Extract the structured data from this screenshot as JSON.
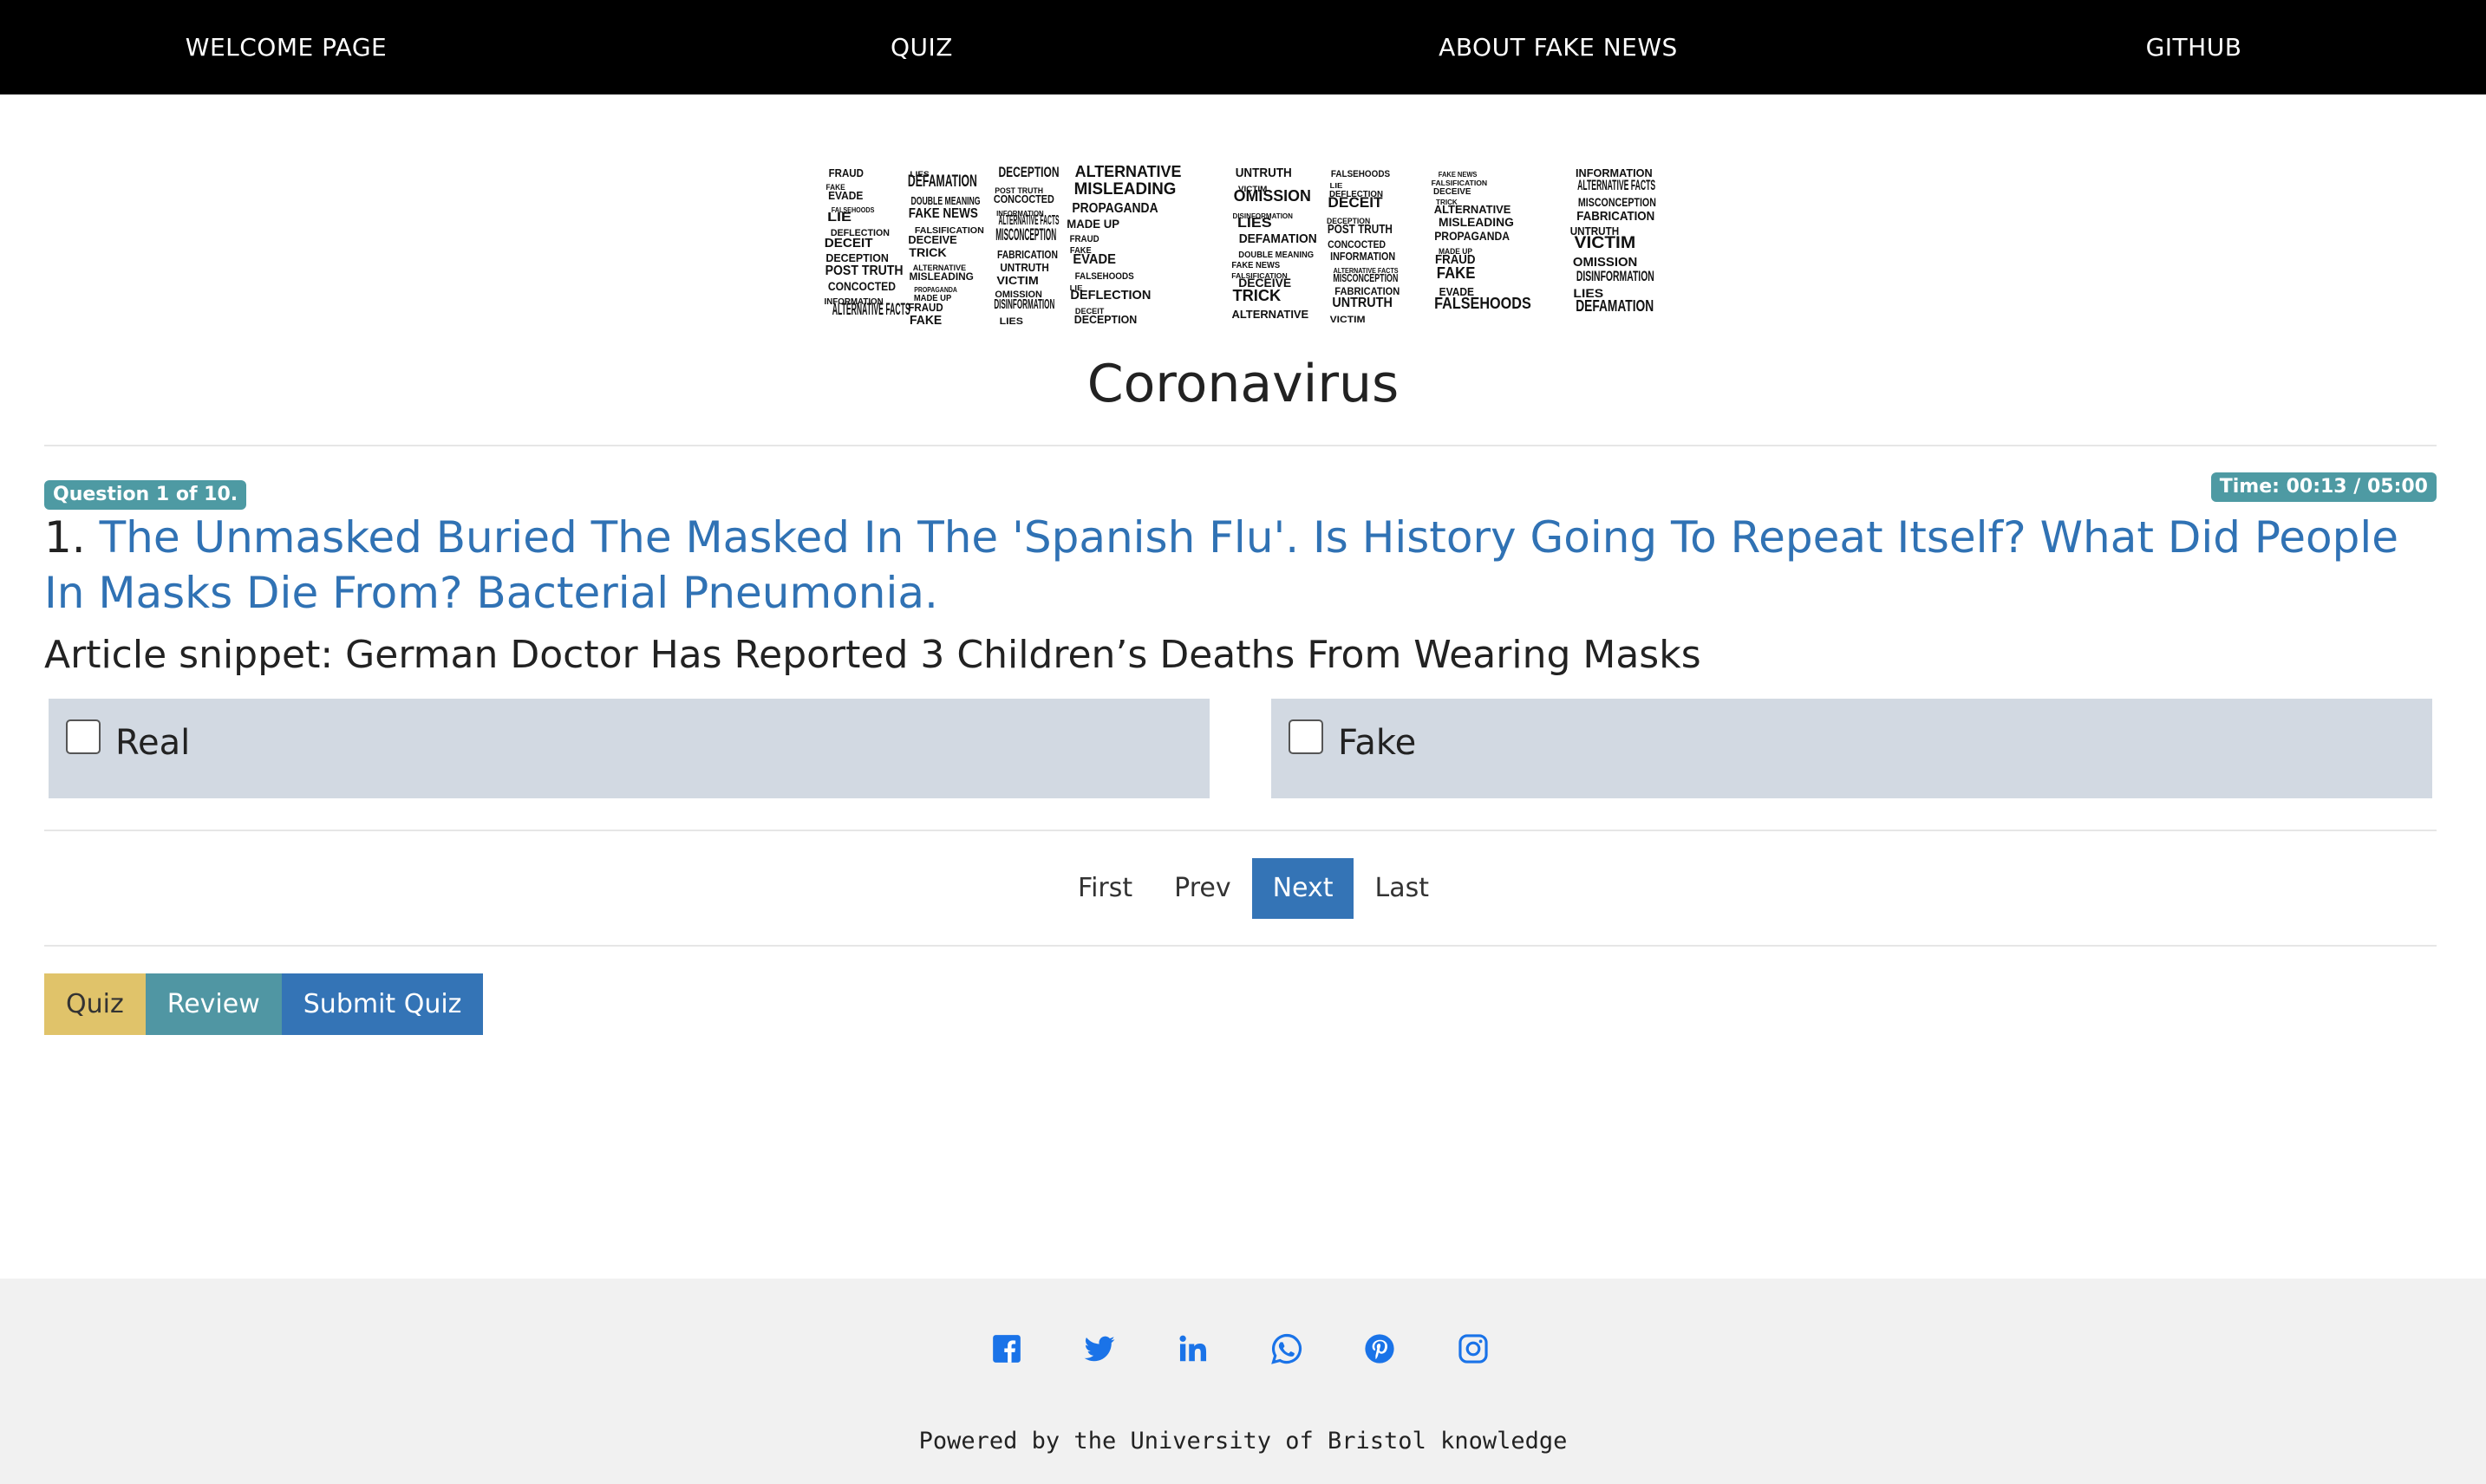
{
  "nav": {
    "items": [
      {
        "label": "WELCOME PAGE"
      },
      {
        "label": "QUIZ"
      },
      {
        "label": "ABOUT FAKE NEWS"
      },
      {
        "label": "GITHUB"
      }
    ]
  },
  "header": {
    "title": "Coronavirus",
    "logo_words": [
      "FRAUD",
      "DECEIT",
      "MISCONCEPTION",
      "LIES",
      "TRICK",
      "FAKE",
      "DECEPTION",
      "FABRICATION",
      "DEFAMATION",
      "ALTERNATIVE",
      "EVADE",
      "POST TRUTH",
      "UNTRUTH",
      "DOUBLE MEANING",
      "MISLEADING",
      "FALSEHOODS",
      "CONCOCTED",
      "VICTIM",
      "FAKE NEWS",
      "PROPAGANDA",
      "LIE",
      "INFORMATION",
      "OMISSION",
      "FALSIFICATION",
      "MADE UP",
      "DEFLECTION",
      "ALTERNATIVE FACTS",
      "DISINFORMATION",
      "DECEIVE"
    ]
  },
  "quiz": {
    "question_badge": "Question 1 of 10.",
    "timer_badge": "Time: 00:13 / 05:00",
    "question_number": "1.",
    "question_link": "The Unmasked Buried The Masked In The 'Spanish Flu'. Is History Going To Repeat Itself? What Did People In Masks Die From? Bacterial Pneumonia.",
    "snippet": "Article snippet: German Doctor Has Reported 3 Children’s Deaths From Wearing Masks",
    "options": [
      {
        "label": "Real",
        "checked": false
      },
      {
        "label": "Fake",
        "checked": false
      }
    ]
  },
  "pager": {
    "first": "First",
    "prev": "Prev",
    "next": "Next",
    "last": "Last",
    "active": "Next"
  },
  "actions": {
    "quiz": "Quiz",
    "review": "Review",
    "submit": "Submit Quiz"
  },
  "footer": {
    "social_icons": [
      "facebook-icon",
      "twitter-icon",
      "linkedin-icon",
      "whatsapp-icon",
      "pinterest-icon",
      "instagram-icon"
    ],
    "powered": "Powered by the University of Bristol knowledge"
  },
  "colors": {
    "nav_bg": "#000000",
    "link": "#3072b4",
    "badge": "#4e9aa3",
    "option_bg": "#d2d9e2",
    "primary": "#3474b6",
    "warning": "#e0c36a",
    "info": "#5096a3",
    "social": "#1a73e8",
    "footer_bg": "#f1f1f1"
  }
}
